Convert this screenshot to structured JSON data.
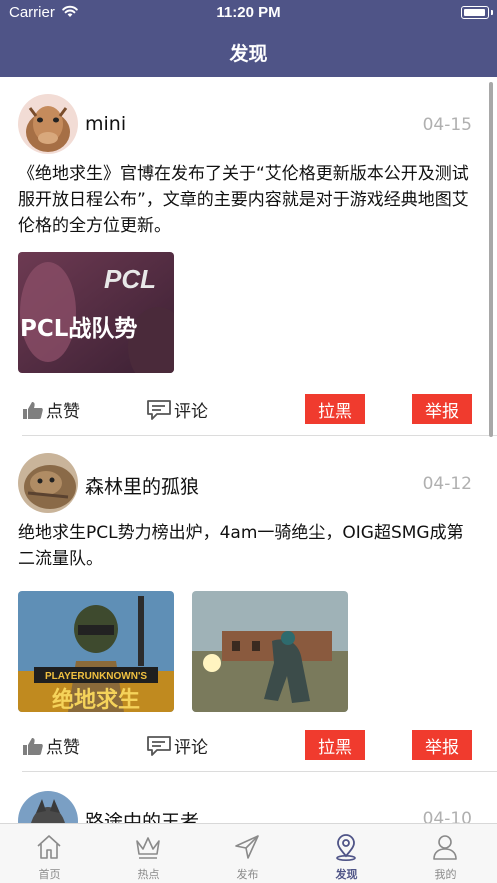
{
  "status_bar": {
    "carrier": "Carrier",
    "time": "11:20 PM"
  },
  "nav": {
    "title": "发现"
  },
  "posts": [
    {
      "username": "mini",
      "date": "04-15",
      "content": "《绝地求生》官博在发布了关于“艾伦格更新版本公开及测试服开放日程公布”，文章的主要内容就是对于游戏经典地图艾伦格的全方位更新。",
      "images": [
        {
          "text": "PCL战队势",
          "logo": "PCL"
        }
      ],
      "like_label": "点赞",
      "comment_label": "评论",
      "block_label": "拉黑",
      "report_label": "举报"
    },
    {
      "username": "森林里的孤狼",
      "date": "04-12",
      "content": "绝地求生PCL势力榜出炉，4am一骑绝尘，OIG超SMG成第二流量队。",
      "images": [
        {
          "text": "PLAYERUNKNOWN'S"
        },
        {
          "text": ""
        }
      ],
      "like_label": "点赞",
      "comment_label": "评论",
      "block_label": "拉黑",
      "report_label": "举报"
    },
    {
      "username": "路途中的王者",
      "date": "04-10"
    }
  ],
  "tabs": [
    {
      "label": "首页",
      "icon": "home-icon",
      "active": false
    },
    {
      "label": "热点",
      "icon": "crown-icon",
      "active": false
    },
    {
      "label": "发布",
      "icon": "send-icon",
      "active": false
    },
    {
      "label": "发现",
      "icon": "location-pin-icon",
      "active": true
    },
    {
      "label": "我的",
      "icon": "user-icon",
      "active": false
    }
  ],
  "colors": {
    "nav_bg": "#4f5487",
    "button_red": "#f03b2e",
    "active_tab": "#4f5487",
    "inactive_tab": "#8a8a8a",
    "date_gray": "#b0b0b0"
  }
}
